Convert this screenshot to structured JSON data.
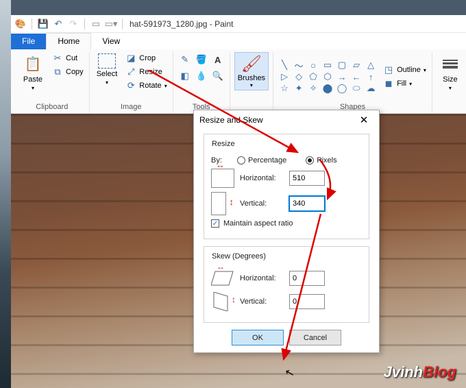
{
  "title": {
    "filename": "hat-591973_1280.jpg",
    "app": "Paint"
  },
  "tabs": {
    "file": "File",
    "home": "Home",
    "view": "View"
  },
  "ribbon": {
    "clipboard": {
      "paste": "Paste",
      "cut": "Cut",
      "copy": "Copy",
      "label": "Clipboard"
    },
    "image": {
      "select": "Select",
      "crop": "Crop",
      "resize": "Resize",
      "rotate": "Rotate",
      "label": "Image"
    },
    "tools": {
      "label": "Tools"
    },
    "brushes": {
      "label": "Brushes"
    },
    "shapes": {
      "outline": "Outline",
      "fill": "Fill",
      "label": "Shapes"
    },
    "size": {
      "label": "Size"
    }
  },
  "dialog": {
    "title": "Resize and Skew",
    "resize": {
      "legend": "Resize",
      "by": "By:",
      "percentage": "Percentage",
      "pixels": "Pixels",
      "horizontal": "Horizontal:",
      "vertical": "Vertical:",
      "h_value": "510",
      "v_value": "340",
      "maintain": "Maintain aspect ratio"
    },
    "skew": {
      "legend": "Skew (Degrees)",
      "horizontal": "Horizontal:",
      "vertical": "Vertical:",
      "h_value": "0",
      "v_value": "0"
    },
    "ok": "OK",
    "cancel": "Cancel"
  },
  "watermark": {
    "a": "Jvinh",
    "b": "Blog"
  }
}
